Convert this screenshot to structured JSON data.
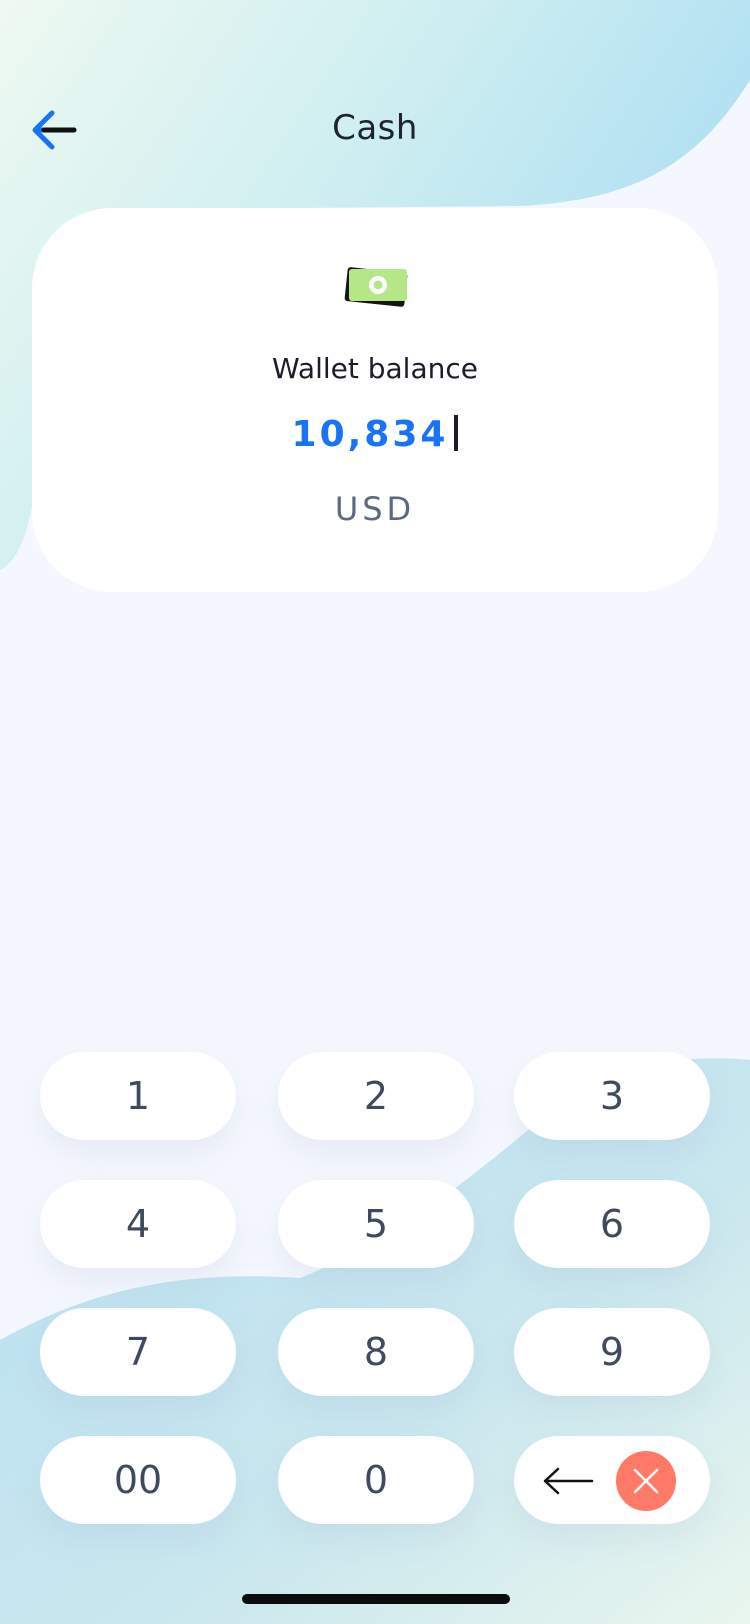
{
  "header": {
    "title": "Cash"
  },
  "balance_card": {
    "label": "Wallet balance",
    "amount": "10,834",
    "currency": "USD"
  },
  "keypad": {
    "keys": [
      "1",
      "2",
      "3",
      "4",
      "5",
      "6",
      "7",
      "8",
      "9",
      "00",
      "0"
    ]
  },
  "icons": {
    "back": "back-arrow-icon",
    "cash": "cash-icon",
    "delete": "backspace-arrow-icon",
    "clear": "close-icon"
  },
  "colors": {
    "accent": "#1a73f5",
    "clear_button": "#ff7a66",
    "cash_green": "#b6e786"
  }
}
